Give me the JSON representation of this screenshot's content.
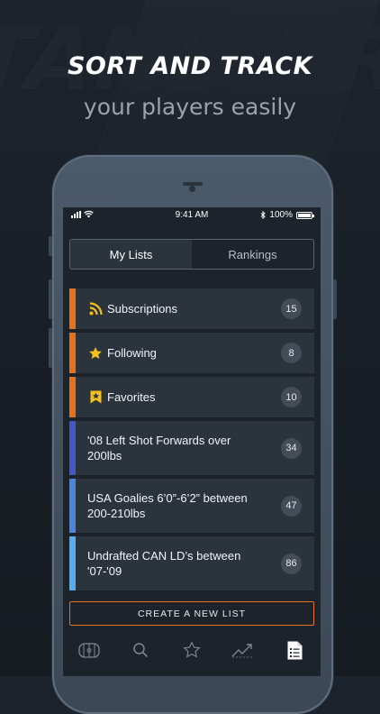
{
  "promo": {
    "headline": "SORT AND TRACK",
    "subhead": "your players easily"
  },
  "status_bar": {
    "time": "9:41 AM",
    "battery": "100%",
    "battery_level": 1.0
  },
  "segmented": {
    "tabs": [
      {
        "label": "My Lists",
        "active": true
      },
      {
        "label": "Rankings",
        "active": false
      }
    ]
  },
  "lists": [
    {
      "label": "Subscriptions",
      "count": "15",
      "icon": "rss-icon",
      "accent": "#e8721c"
    },
    {
      "label": "Following",
      "count": "8",
      "icon": "star-icon",
      "accent": "#e8721c"
    },
    {
      "label": "Favorites",
      "count": "10",
      "icon": "bookmark-star-icon",
      "accent": "#e8721c"
    },
    {
      "label": "'08 Left Shot Forwards over 200lbs",
      "count": "34",
      "accent": "#4457c8"
    },
    {
      "label": "USA Goalies 6’0”-6’2” between 200-210lbs",
      "count": "47",
      "accent": "#4a86dc"
    },
    {
      "label": "Undrafted CAN LD’s between '07-'09",
      "count": "86",
      "accent": "#55aef0"
    }
  ],
  "create_button": "CREATE A NEW LIST",
  "tab_bar": [
    {
      "icon": "rink-icon",
      "active": false
    },
    {
      "icon": "search-icon",
      "active": false
    },
    {
      "icon": "star-outline-icon",
      "active": false
    },
    {
      "icon": "trending-icon",
      "active": false
    },
    {
      "icon": "list-document-icon",
      "active": true
    }
  ],
  "colors": {
    "accent_orange": "#e8721c",
    "background": "#1d232b",
    "row": "#2b333c",
    "icon_yellow": "#f3c21a"
  }
}
